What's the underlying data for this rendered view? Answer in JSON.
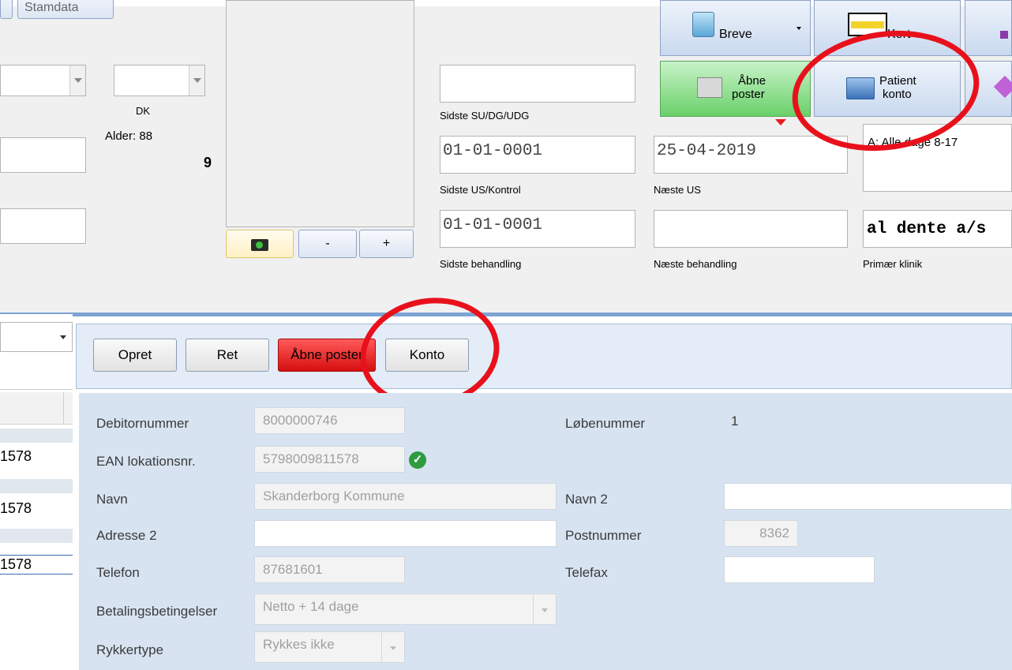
{
  "patient": {
    "nationality": "DK",
    "age_label": "Alder: 88",
    "number": "9"
  },
  "photo_controls": {
    "camera_icon": "camera-icon",
    "minus_label": "-",
    "plus_label": "+"
  },
  "dates": {
    "last_su_label": "Sidste SU/DG/UDG",
    "last_us_value": "01-01-0001",
    "last_us_label": "Sidste US/Kontrol",
    "next_us_value": "25-04-2019",
    "next_us_label": "Næste US",
    "last_treatment_value": "01-01-0001",
    "last_treatment_label": "Sidste behandling",
    "next_treatment_label": "Næste behandling"
  },
  "clinic": {
    "hours_text": "A: Alle dage 8-17",
    "primary_clinic_value": "al dente a/s",
    "primary_clinic_label": "Primær klinik"
  },
  "toolbar": {
    "letters_label": "Breve",
    "card_label": "Kort",
    "open_items_label_line1": "Åbne",
    "open_items_label_line2": "poster",
    "patient_account_line1": "Patient",
    "patient_account_line2": "konto",
    "top_left_button_label": "Stamdata"
  },
  "actions": {
    "create": "Opret",
    "edit": "Ret",
    "open_items": "Åbne poster",
    "account": "Konto"
  },
  "left_list": {
    "rows": [
      "1578",
      "1578",
      "1578"
    ]
  },
  "debtor": {
    "debtor_number_label": "Debitornummer",
    "debtor_number_value": "8000000746",
    "serial_label": "Løbenummer",
    "serial_value": "1",
    "ean_label": "EAN lokationsnr.",
    "ean_value": "5798009811578",
    "name_label": "Navn",
    "name_value": "Skanderborg Kommune",
    "name2_label": "Navn 2",
    "address2_label": "Adresse 2",
    "postal_label": "Postnummer",
    "postal_value": "8362",
    "phone_label": "Telefon",
    "phone_value": "87681601",
    "fax_label": "Telefax",
    "payment_terms_label": "Betalingsbetingelser",
    "payment_terms_value": "Netto + 14 dage",
    "reminder_type_label": "Rykkertype",
    "reminder_type_value": "Rykkes ikke"
  },
  "colors": {
    "annotation_red": "#e8111b",
    "open_items_green": "#7fdc7f",
    "open_items_red": "#e51e1e",
    "form_bg": "#d7e3f1"
  }
}
